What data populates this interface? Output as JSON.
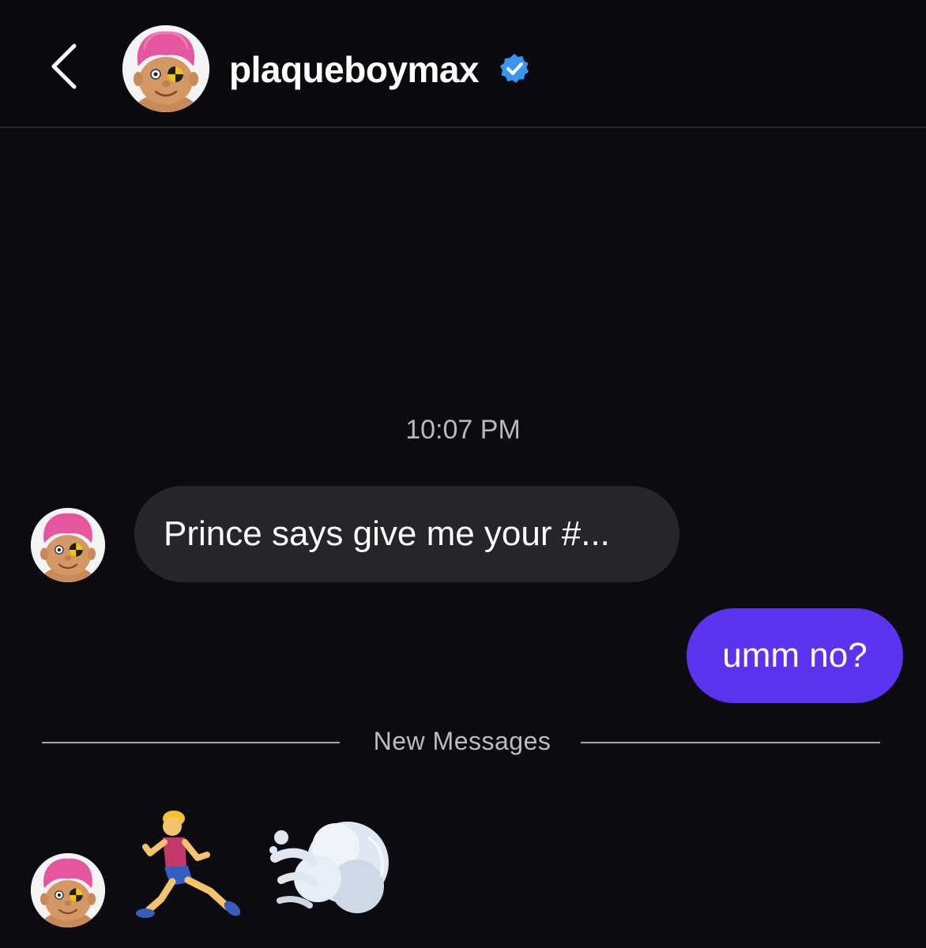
{
  "header": {
    "username": "plaqueboymax",
    "verified": true,
    "back_icon": "chevron-left-icon",
    "verified_icon": "verified-badge-icon"
  },
  "conversation": {
    "timestamp": "10:07 PM",
    "messages": [
      {
        "direction": "incoming",
        "text": "Prince says give me your #..."
      },
      {
        "direction": "outgoing",
        "text": "umm no?"
      }
    ],
    "divider_label": "New Messages",
    "new_messages": [
      {
        "direction": "incoming",
        "emoji": [
          "person-running-icon",
          "dashing-away-icon"
        ]
      }
    ]
  },
  "colors": {
    "background": "#0c0c10",
    "incoming_bubble": "#26262a",
    "outgoing_bubble": "#5b33f0",
    "verified_badge": "#3797f0"
  }
}
